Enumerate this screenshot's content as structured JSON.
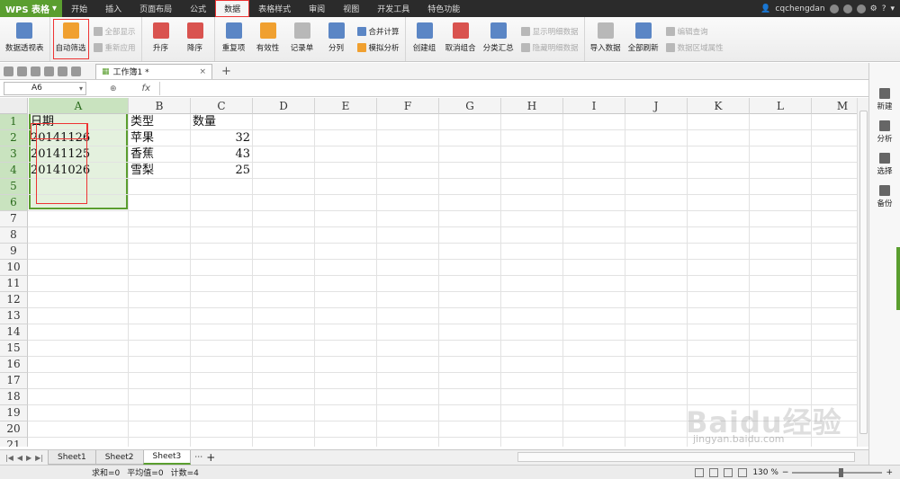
{
  "app": {
    "logo": "WPS 表格",
    "user": "cqchengdan"
  },
  "menu": [
    "开始",
    "插入",
    "页面布局",
    "公式",
    "数据",
    "表格样式",
    "审阅",
    "视图",
    "开发工具",
    "特色功能"
  ],
  "menu_active_index": 4,
  "ribbon": {
    "pivot": "数据透视表",
    "autofilter": "自动筛选",
    "show_all": "全部显示",
    "reapply": "重新应用",
    "sort_asc": "升序",
    "sort_desc": "降序",
    "duplicates": "重复项",
    "validity": "有效性",
    "record": "记录单",
    "split": "分列",
    "consolidate": "合并计算",
    "whatif": "模拟分析",
    "group": "创建组",
    "ungroup": "取消组合",
    "subtotal": "分类汇总",
    "show_detail": "显示明细数据",
    "hide_detail": "隐藏明细数据",
    "import": "导入数据",
    "refresh_all": "全部刷新",
    "edit_query": "编辑查询",
    "range_props": "数据区域属性"
  },
  "doc_tab": {
    "name": "工作簿1 *",
    "close": "×",
    "add": "+"
  },
  "formula_bar": {
    "name_box": "A6",
    "fx": "fx",
    "value": ""
  },
  "columns": [
    "A",
    "B",
    "C",
    "D",
    "E",
    "F",
    "G",
    "H",
    "I",
    "J",
    "K",
    "L",
    "M"
  ],
  "rows": [
    "1",
    "2",
    "3",
    "4",
    "5",
    "6",
    "7",
    "8",
    "9",
    "10",
    "11",
    "12",
    "13",
    "14",
    "15",
    "16",
    "17",
    "18",
    "19",
    "20",
    "21"
  ],
  "cells": {
    "A1": "日期",
    "B1": "类型",
    "C1": "数量",
    "A2": "20141126",
    "B2": "苹果",
    "C2": "32",
    "A3": "20141125",
    "B3": "香蕉",
    "C3": "43",
    "A4": "20141026",
    "B4": "雪梨",
    "C4": "25"
  },
  "side_panel": [
    "新建",
    "分析",
    "选择",
    "备份"
  ],
  "sheets": [
    "Sheet1",
    "Sheet2",
    "Sheet3"
  ],
  "active_sheet": "Sheet3",
  "status": {
    "sum": "求和=0",
    "avg": "平均值=0",
    "count": "计数=4",
    "zoom": "130 %"
  },
  "watermark": {
    "main": "Baidu经验",
    "sub": "jingyan.baidu.com"
  }
}
